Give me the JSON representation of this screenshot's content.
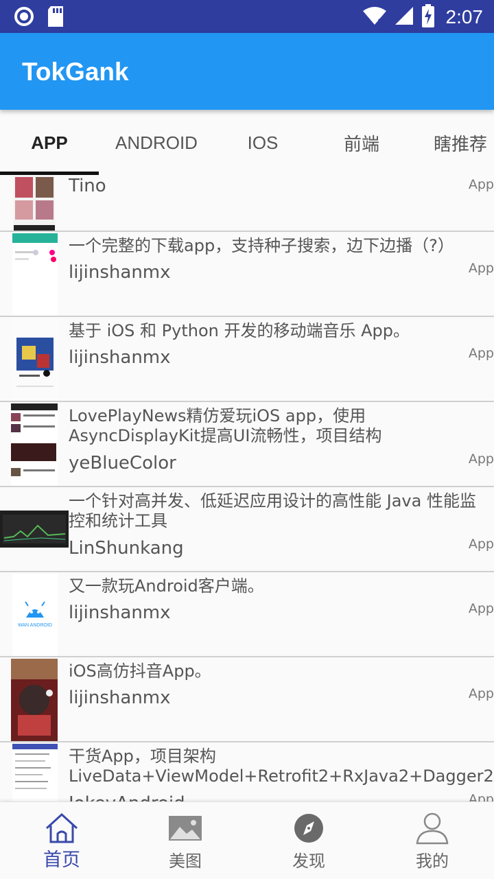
{
  "status_bar": {
    "time": "2:07",
    "icons": [
      "notification-circle-icon",
      "sd-card-icon",
      "wifi-icon",
      "signal-icon",
      "battery-charging-icon"
    ]
  },
  "app_bar": {
    "title": "TokGank"
  },
  "tabs": [
    {
      "label": "APP",
      "active": true
    },
    {
      "label": "ANDROID",
      "active": false
    },
    {
      "label": "IOS",
      "active": false
    },
    {
      "label": "前端",
      "active": false
    },
    {
      "label": "瞎推荐",
      "active": false
    }
  ],
  "list": [
    {
      "title": "",
      "author": "Tino",
      "type": "App"
    },
    {
      "title": "一个完整的下载app，支持种子搜索，边下边播（?）",
      "author": "lijinshanmx",
      "type": "App"
    },
    {
      "title": "基于 iOS 和 Python 开发的移动端音乐 App。",
      "author": "lijinshanmx",
      "type": "App"
    },
    {
      "title": "LovePlayNews精仿爱玩iOS app，使用AsyncDisplayKit提高UI流畅性，项目结构",
      "author": "yeBlueColor",
      "type": "App"
    },
    {
      "title": "一个针对高并发、低延迟应用设计的高性能 Java 性能监控和统计工具",
      "author": "LinShunkang",
      "type": "App"
    },
    {
      "title": "又一款玩Android客户端。",
      "author": "lijinshanmx",
      "type": "App",
      "thumb_text": "WAN ANDROID"
    },
    {
      "title": "iOS高仿抖音App。",
      "author": "lijinshanmx",
      "type": "App"
    },
    {
      "title": "干货App，项目架构LiveData+ViewModel+Retrofit2+RxJava2+Dagger2，",
      "author": "JokeyAndroid",
      "type": "App"
    }
  ],
  "bottom_nav": [
    {
      "label": "首页",
      "icon": "home-icon",
      "active": true
    },
    {
      "label": "美图",
      "icon": "image-icon",
      "active": false
    },
    {
      "label": "发现",
      "icon": "compass-icon",
      "active": false
    },
    {
      "label": "我的",
      "icon": "person-icon",
      "active": false
    }
  ],
  "colors": {
    "status_bar": "#2f3d9f",
    "app_bar": "#2196f3",
    "nav_active": "#3949ab"
  }
}
